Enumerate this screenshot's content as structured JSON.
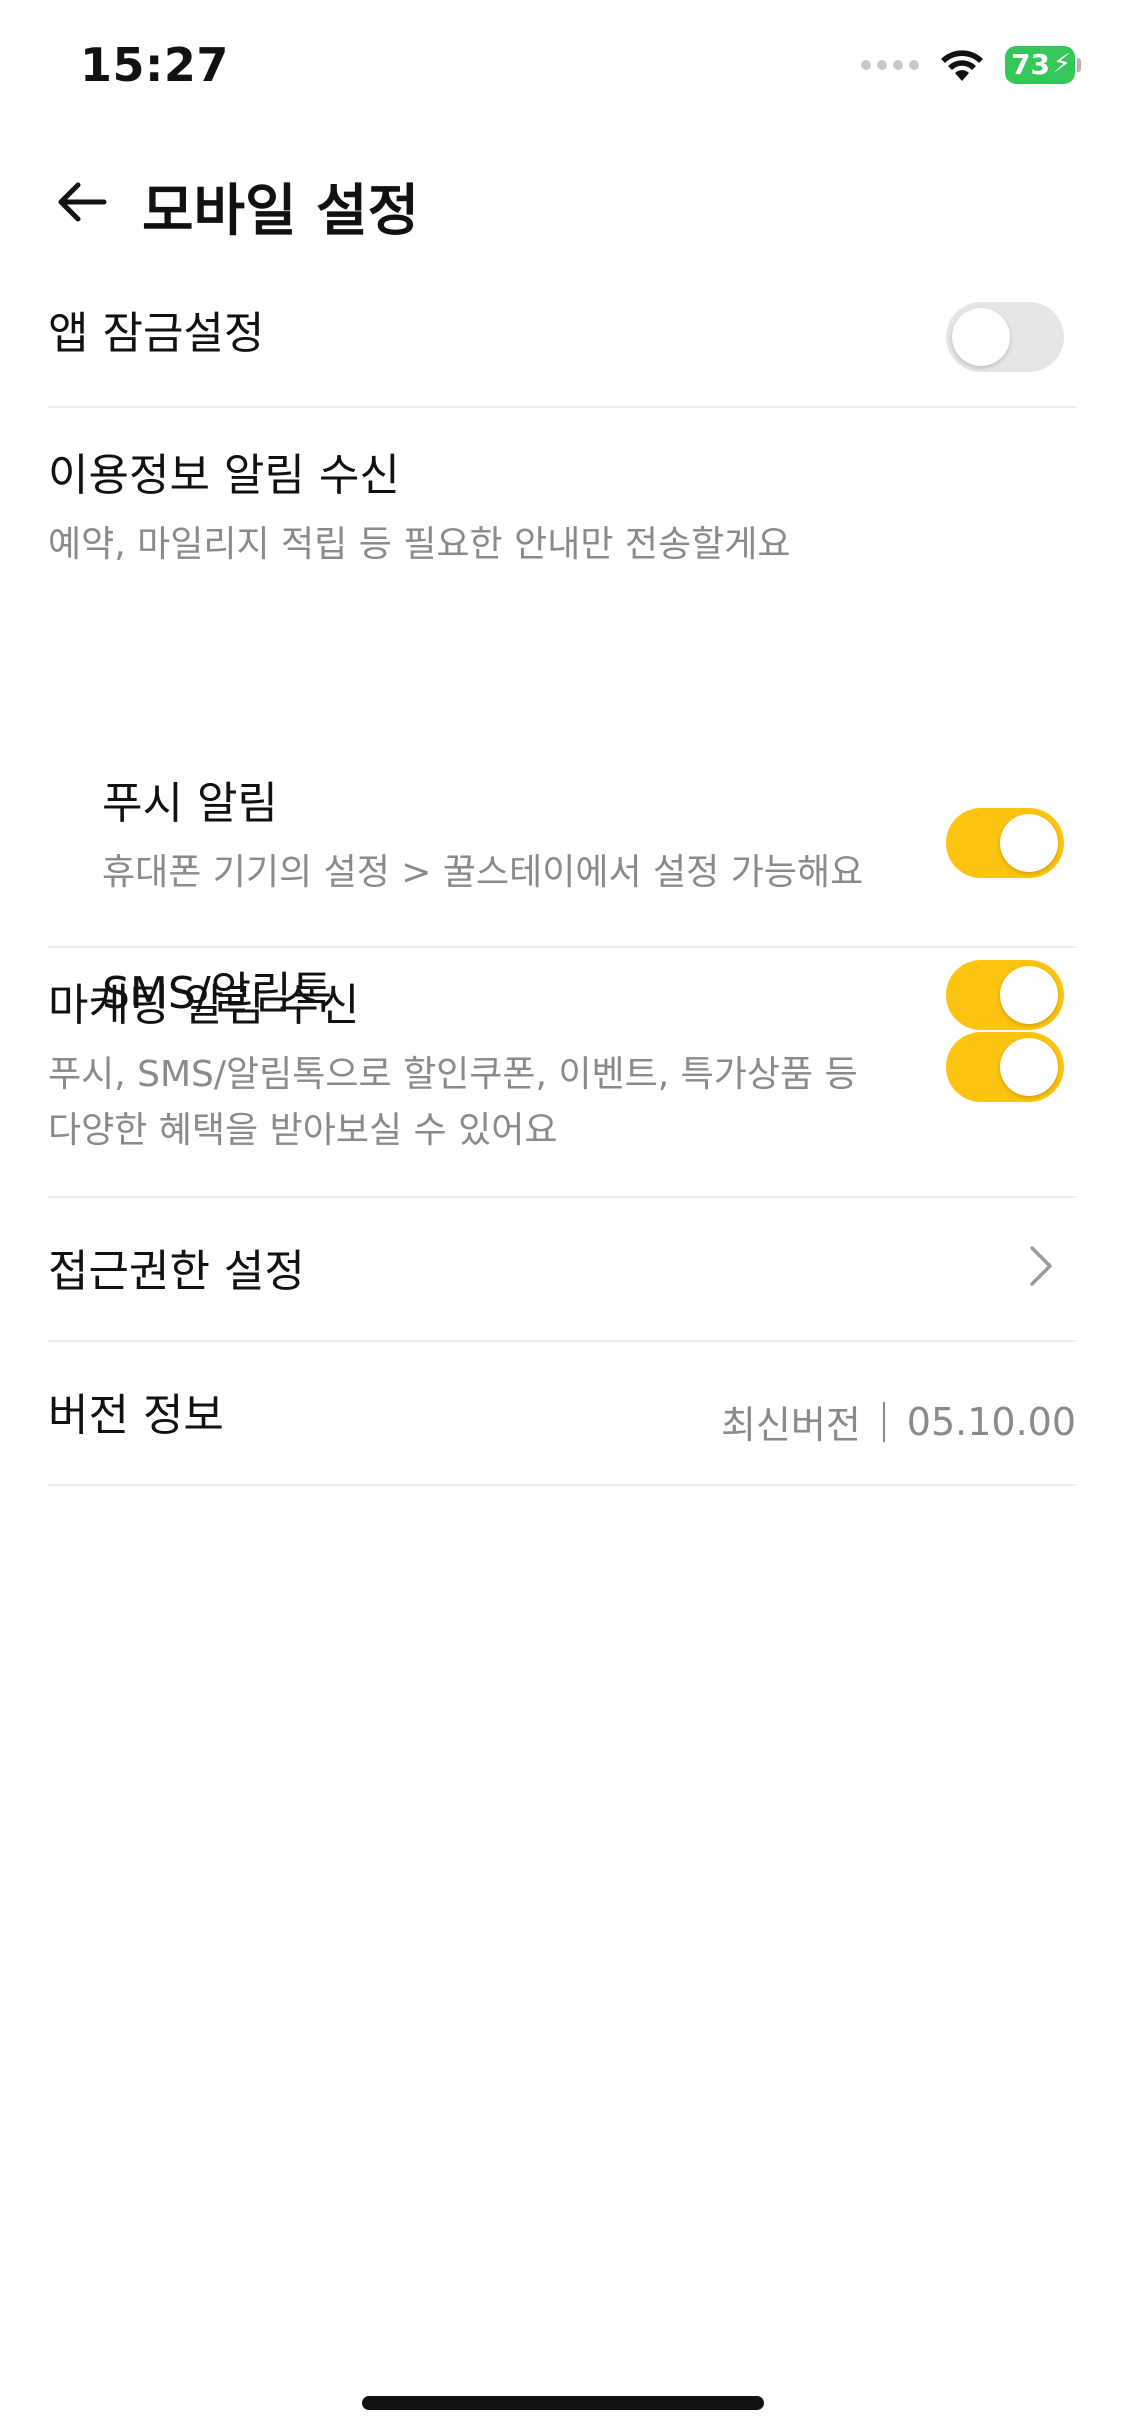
{
  "status_bar": {
    "time": "15:27",
    "battery_level": "73",
    "battery_color": "#36c759"
  },
  "header": {
    "title": "모바일 설정",
    "back_icon": "arrow-left-icon"
  },
  "settings": {
    "app_lock": {
      "title": "앱 잠금설정",
      "enabled": false
    },
    "usage_notifications": {
      "title": "이용정보 알림 수신",
      "description": "예약, 마일리지 적립 등 필요한 안내만 전송할게요",
      "push": {
        "title": "푸시 알림",
        "description": "휴대폰 기기의 설정 > 꿀스테이에서 설정 가능해요",
        "enabled": true
      },
      "sms": {
        "title": "SMS/알림톡",
        "enabled": true
      }
    },
    "marketing_notifications": {
      "title": "마케팅 알림 수신",
      "description_line1": "푸시, SMS/알림톡으로 할인쿠폰, 이벤트, 특가상품 등",
      "description_line2": "다양한 혜택을 받아보실 수 있어요",
      "enabled": true
    },
    "permissions": {
      "title": "접근권한 설정",
      "icon": "chevron-right-icon"
    },
    "version": {
      "title": "버전 정보",
      "status": "최신버전",
      "number": "05.10.00"
    }
  },
  "colors": {
    "toggle_on": "#fcc310",
    "toggle_off": "#e6e6e6",
    "divider": "#ececec",
    "secondary_text": "#8a8a8a"
  }
}
